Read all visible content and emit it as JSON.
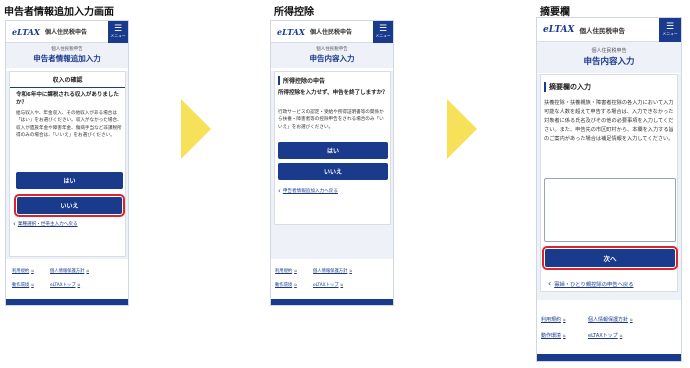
{
  "captions": {
    "screen1": "申告者情報追加入力画面",
    "screen2": "所得控除",
    "screen3": "摘要欄"
  },
  "common": {
    "logo": "eLTAX",
    "app_title": "個人住民税申告",
    "menu_label": "メニュー",
    "menu_glyph": "☰",
    "ext_glyph": "⧉",
    "back_glyph": "‹"
  },
  "screen1": {
    "header_sub": "個人住民税申告",
    "header_main": "申告者情報追加入力",
    "panel_title": "収入の確認",
    "question": "令和6年中に課税される収入がありましたか？",
    "text": "給与収入や、年金収入、その他収入がある場合は「はい」をお選びください。収入がなかった場合、収入が遺族年金や障害年金、傷病手当など非課税所得のみの場合は、「いいえ」をお選びください。",
    "yes_label": "はい",
    "no_label": "いいえ",
    "back_link": "業種選択・世帯主入力へ戻る",
    "footer": [
      "利用規約",
      "個人情報保護方針",
      "動作環境",
      "eLTAXトップ"
    ]
  },
  "screen2": {
    "header_sub": "個人住民税申告",
    "header_main": "申告内容入力",
    "section_title": "所得控除の申告",
    "question": "所得控除を入力せず、申告を終了しますか？",
    "text": "行政サービスの認定・受給や所得証明書等の関係から扶養・障害者等の控除申告をされる場合のみ「いいえ」をお選びください。",
    "yes_label": "はい",
    "no_label": "いいえ",
    "back_link": "申告者情報追加入力へ戻る",
    "footer": [
      "利用規約",
      "個人情報保護方針",
      "動作環境",
      "eLTAXトップ"
    ]
  },
  "screen3": {
    "header_sub": "個人住民税申告",
    "header_main": "申告内容入力",
    "section_title": "摘要欄の入力",
    "text": "扶養控除・扶養親族・障害者控除の各入力において入力可能な人数を超えて申告する場合は、入力できなかった対象者に係る氏名及びその他の必要事項を入力してください。また、申告先の市区町村から、本欄を入力する旨のご案内があった場合は補足情報を入力してください。",
    "textarea_value": "",
    "next_label": "次へ",
    "back_link": "寡婦・ひとり親控除の申告へ戻る",
    "footer": [
      "利用規約",
      "個人情報保護方針",
      "動作環境",
      "eLTAXトップ"
    ]
  },
  "colors": {
    "primary": "#1a3a8c",
    "highlight": "#d9262c",
    "arrow": "#f7e15a"
  }
}
